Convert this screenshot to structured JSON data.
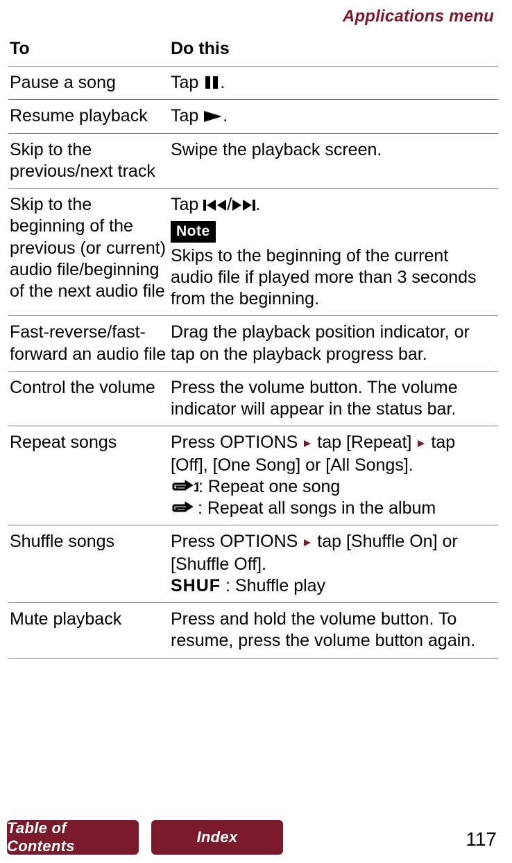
{
  "header_title": "Applications menu",
  "table": {
    "headers": {
      "to": "To",
      "do_this": "Do this"
    },
    "rows": {
      "pause": {
        "to": "Pause a song",
        "do_pre": "Tap ",
        "do_post": "."
      },
      "resume": {
        "to": "Resume playback",
        "do_pre": "Tap ",
        "do_post": "."
      },
      "skip_prev_next": {
        "to": "Skip to the previous/next track",
        "do": "Swipe the playback screen."
      },
      "skip_beginning": {
        "to": "Skip to the beginning of the previous (or current) audio file/beginning of the next audio file",
        "do_pre": "Tap ",
        "do_mid": "/",
        "do_post": ".",
        "note_label": "Note",
        "note_text": "Skips to the beginning of the current audio file if played more than 3 seconds from the beginning."
      },
      "fast": {
        "to": "Fast-reverse/fast-forward an audio file",
        "do": "Drag the playback position indicator, or tap on the playback progress bar."
      },
      "volume": {
        "to": "Control the volume",
        "do": "Press the volume button. The volume indicator will appear in the status bar."
      },
      "repeat": {
        "to": "Repeat songs",
        "line1_a": "Press OPTIONS ",
        "line1_b": " tap [Repeat] ",
        "line1_c": " tap [Off], [One Song] or [All Songs].",
        "one": ": Repeat one song",
        "all": " : Repeat all songs in the album"
      },
      "shuffle": {
        "to": "Shuffle songs",
        "line1_a": "Press OPTIONS ",
        "line1_b": " tap [Shuffle On] or [Shuffle Off].",
        "shuf_label": "SHUF",
        "shuf_desc": " : Shuffle play"
      },
      "mute": {
        "to": "Mute playback",
        "do": "Press and hold the volume button. To resume, press the volume button again."
      }
    }
  },
  "footer": {
    "toc": "Table of Contents",
    "index": "Index",
    "page_number": "117"
  }
}
